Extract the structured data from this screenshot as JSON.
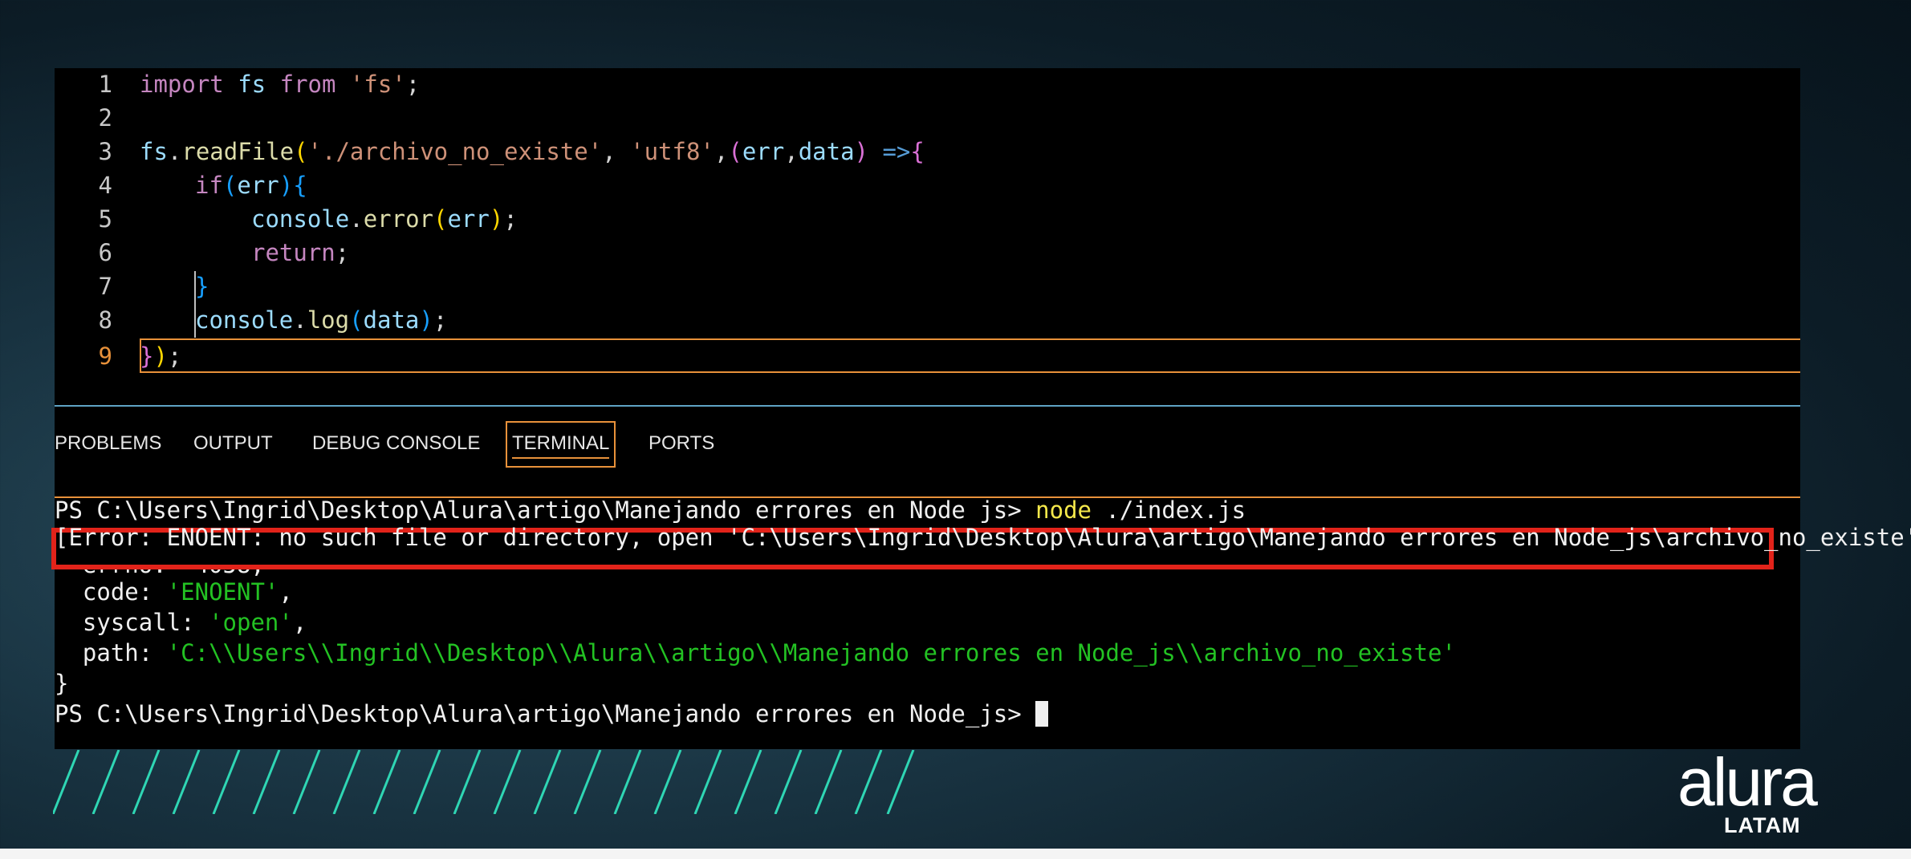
{
  "editor": {
    "line_numbers": [
      "1",
      "2",
      "3",
      "4",
      "5",
      "6",
      "7",
      "8",
      "9"
    ],
    "active_line": "9",
    "lines": {
      "l1": {
        "kw_import": "import",
        "id_fs": " fs ",
        "kw_from": "from",
        "str": " 'fs'",
        "semi": ";"
      },
      "l3": {
        "obj": "fs",
        "dot": ".",
        "fn": "readFile",
        "paren_open": "(",
        "str1": "'./archivo_no_existe'",
        "comma1": ", ",
        "str2": "'utf8'",
        "comma2": ",",
        "paren2_open": "(",
        "p1": "err",
        "comma3": ",",
        "p2": "data",
        "paren2_close": ")",
        "arrow": " =>",
        "brace": "{"
      },
      "l4": {
        "kw": "if",
        "paren_open": "(",
        "id": "err",
        "paren_close": ")",
        "brace": "{"
      },
      "l5": {
        "obj": "console",
        "dot": ".",
        "fn": "error",
        "paren_open": "(",
        "id": "err",
        "paren_close": ")",
        "semi": ";"
      },
      "l6": {
        "kw": "return",
        "semi": ";"
      },
      "l7": {
        "brace": "}"
      },
      "l8": {
        "obj": "console",
        "dot": ".",
        "fn": "log",
        "paren_open": "(",
        "id": "data",
        "paren_close": ")",
        "semi": ";"
      },
      "l9": {
        "brace": "}",
        "paren_close": ")",
        "semi": ";"
      }
    }
  },
  "panel": {
    "tabs": [
      "PROBLEMS",
      "OUTPUT",
      "DEBUG CONSOLE",
      "TERMINAL",
      "PORTS"
    ],
    "active_tab": "TERMINAL"
  },
  "terminal": {
    "prompt1": "PS C:\\Users\\Ingrid\\Desktop\\Alura\\artigo\\Manejando errores en Node js> ",
    "cmd": "node",
    "cmd_arg": " ./index.js",
    "error_line": "[Error: ENOENT: no such file or directory, open 'C:\\Users\\Ingrid\\Desktop\\Alura\\artigo\\Manejando errores en Node_js\\archivo_no_existe']",
    "error_brace": " {",
    "errno_partial": "  errno: -4058,",
    "code_key": "  code: ",
    "code_val": "'ENOENT'",
    "code_comma": ",",
    "syscall_key": "  syscall: ",
    "syscall_val": "'open'",
    "syscall_comma": ",",
    "path_key": "  path: ",
    "path_val": "'C:\\\\Users\\\\Ingrid\\\\Desktop\\\\Alura\\\\artigo\\\\Manejando errores en Node_js\\\\archivo_no_existe'",
    "close_brace": "}",
    "prompt2": "PS C:\\Users\\Ingrid\\Desktop\\Alura\\artigo\\Manejando errores en Node_js> "
  },
  "brand": {
    "logo_main": "alura",
    "logo_sub": "LATAM"
  },
  "colors": {
    "accent_orange": "#e8913a",
    "highlight_red": "#e2231a",
    "stripe_teal": "#2fd6b4"
  }
}
